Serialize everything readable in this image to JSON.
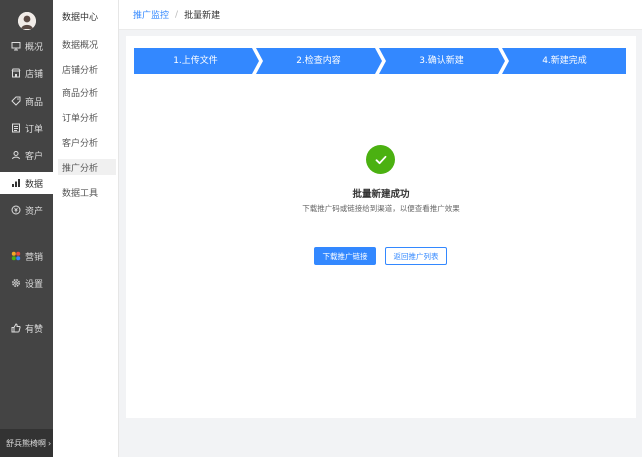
{
  "nav": {
    "items": [
      {
        "label": "概况",
        "icon": "monitor-icon"
      },
      {
        "label": "店铺",
        "icon": "store-icon"
      },
      {
        "label": "商品",
        "icon": "tag-icon"
      },
      {
        "label": "订单",
        "icon": "document-icon"
      },
      {
        "label": "客户",
        "icon": "user-icon"
      },
      {
        "label": "数据",
        "icon": "bar-chart-icon",
        "active": true
      },
      {
        "label": "资产",
        "icon": "yen-coin-icon"
      },
      {
        "label": "营销",
        "icon": "grid-apps-icon"
      },
      {
        "label": "设置",
        "icon": "gear-icon"
      },
      {
        "label": "有赞",
        "icon": "thumbs-up-icon"
      }
    ],
    "footer": "舒兵熊椅啊",
    "footer_chevron": "›"
  },
  "subnav": {
    "title": "数据中心",
    "items": [
      "数据概况",
      "店铺分析",
      "商品分析",
      "订单分析",
      "客户分析",
      "推广分析",
      "数据工具"
    ],
    "active_index": 5
  },
  "breadcrumb": {
    "parent": "推广监控",
    "separator": "/",
    "current": "批量新建"
  },
  "steps": [
    "1.上传文件",
    "2.检查内容",
    "3.确认新建",
    "4.新建完成"
  ],
  "result": {
    "title": "批量新建成功",
    "description": "下载推广码或链接给到渠道，以便查看推广效果"
  },
  "buttons": {
    "download": "下载推广链接",
    "back": "返回推广列表"
  },
  "colors": {
    "accent": "#3388ff",
    "success": "#4bb111",
    "nav_bg": "#444444"
  }
}
